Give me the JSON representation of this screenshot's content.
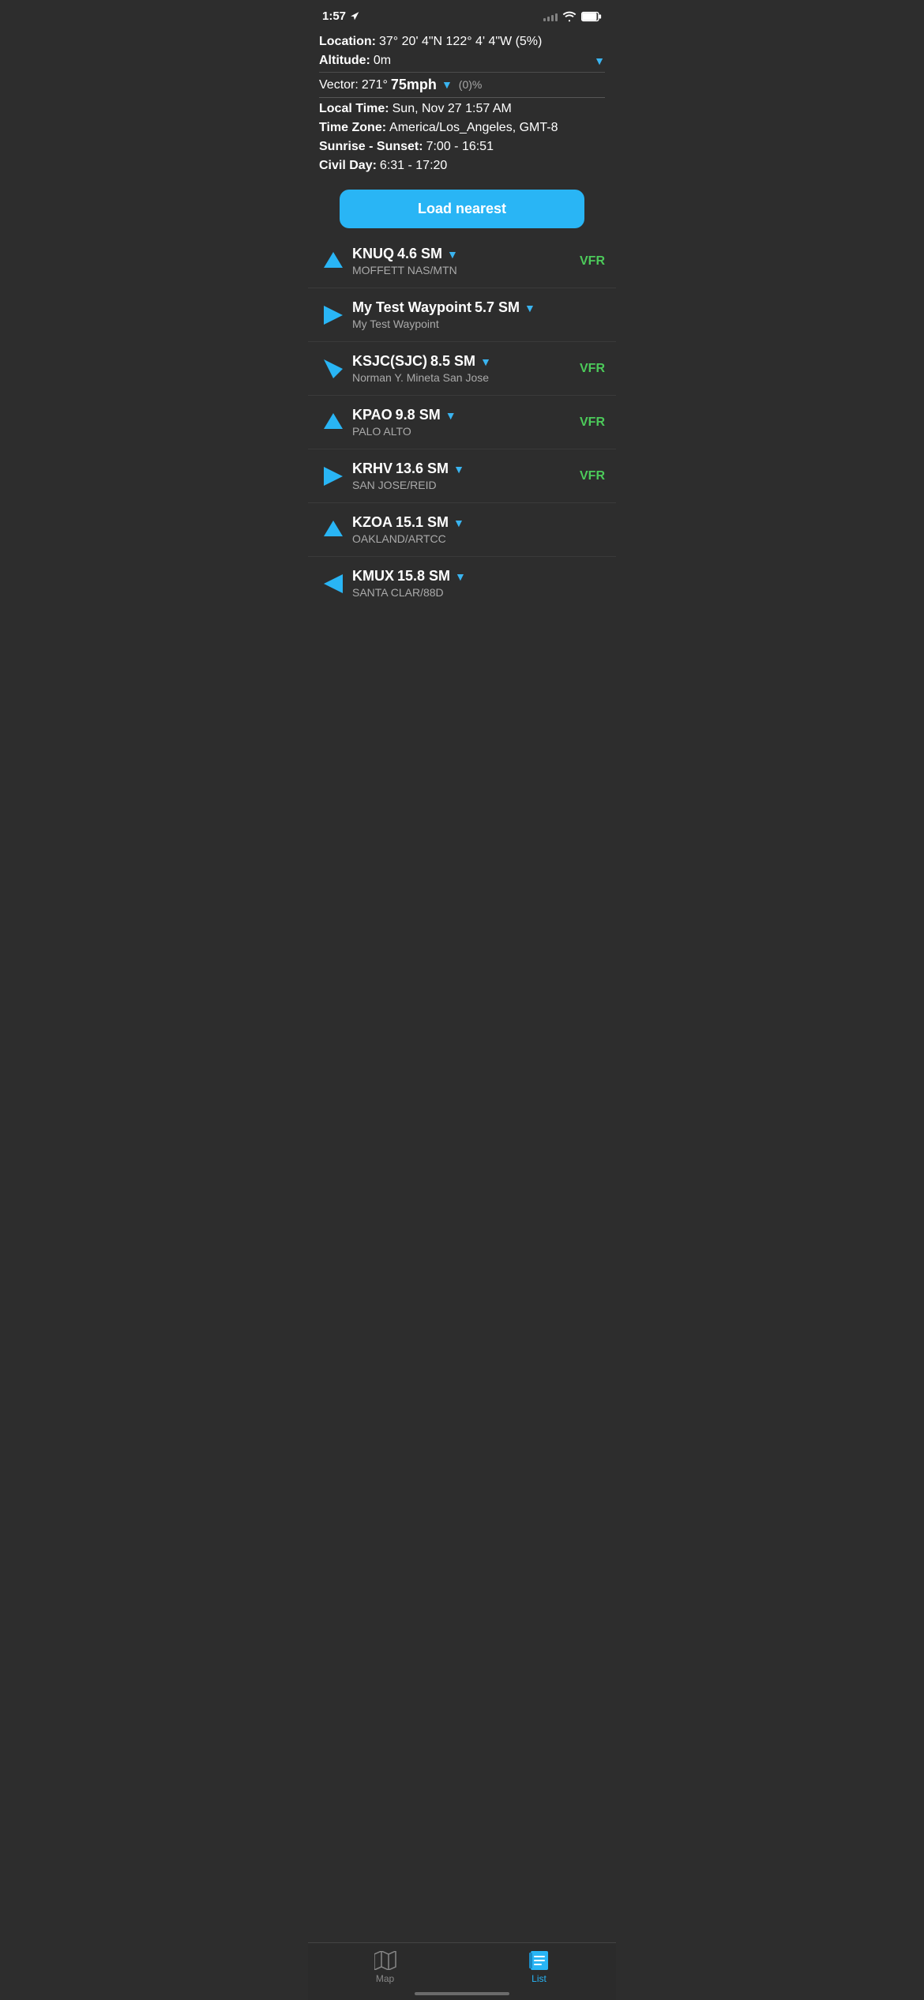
{
  "status": {
    "time": "1:57",
    "location_icon": "location-arrow-icon"
  },
  "location": {
    "label": "Location:",
    "value": "37° 20' 4\"N 122° 4' 4\"W (5%)"
  },
  "altitude": {
    "label": "Altitude:",
    "value": "0m"
  },
  "vector": {
    "label": "Vector:",
    "bearing": "271°",
    "speed": "75mph",
    "percent": "(0)%"
  },
  "local_time": {
    "label": "Local Time:",
    "value": "Sun, Nov 27 1:57 AM"
  },
  "time_zone": {
    "label": "Time Zone:",
    "value": "America/Los_Angeles, GMT-8"
  },
  "sunrise_sunset": {
    "label": "Sunrise - Sunset:",
    "value": "7:00 - 16:51"
  },
  "civil_day": {
    "label": "Civil Day:",
    "value": "6:31 - 17:20"
  },
  "load_nearest_btn": "Load nearest",
  "waypoints": [
    {
      "id": "KNUQ",
      "distance": "4.6 SM",
      "name": "MOFFETT NAS/MTN",
      "vfr": "VFR",
      "arrow": "up",
      "has_dropdown": true
    },
    {
      "id": "My Test Waypoint",
      "distance": "5.7 SM",
      "name": "My Test Waypoint",
      "vfr": "",
      "arrow": "right",
      "has_dropdown": true
    },
    {
      "id": "KSJC(SJC)",
      "distance": "8.5 SM",
      "name": "Norman Y. Mineta San Jose",
      "vfr": "VFR",
      "arrow": "down-right",
      "has_dropdown": true
    },
    {
      "id": "KPAO",
      "distance": "9.8 SM",
      "name": "PALO ALTO",
      "vfr": "VFR",
      "arrow": "up",
      "has_dropdown": true
    },
    {
      "id": "KRHV",
      "distance": "13.6 SM",
      "name": "SAN JOSE/REID",
      "vfr": "VFR",
      "arrow": "right",
      "has_dropdown": true
    },
    {
      "id": "KZOA",
      "distance": "15.1 SM",
      "name": "OAKLAND/ARTCC",
      "vfr": "",
      "arrow": "up",
      "has_dropdown": true
    },
    {
      "id": "KMUX",
      "distance": "15.8 SM",
      "name": "SANTA CLAR/88D",
      "vfr": "",
      "arrow": "left",
      "has_dropdown": true
    }
  ],
  "tabs": {
    "map": {
      "label": "Map",
      "active": false
    },
    "list": {
      "label": "List",
      "active": true
    }
  }
}
